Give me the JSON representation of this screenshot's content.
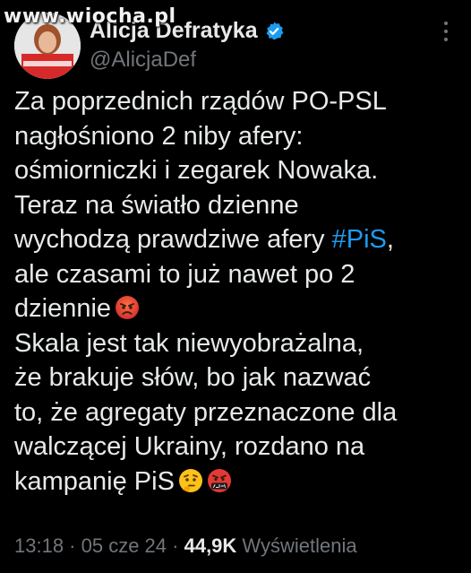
{
  "watermark": "www.wiocha.pl",
  "author": {
    "display_name": "Alicja Defratyka",
    "handle": "@AlicjaDef",
    "verified_icon": "verified-badge-icon",
    "verified_color": "#1d9bf0"
  },
  "tweet": {
    "lines": [
      "Za poprzednich rządów PO-PSL",
      "nagłośniono 2 niby afery:",
      "ośmiorniczki i zegarek Nowaka.",
      "Teraz na światło dzienne",
      "wychodzą prawdziwe afery ",
      "ale czasami to już nawet po 2",
      "dziennie",
      "Skala jest tak niewyobrażalna,",
      "że brakuje słów, bo jak nazwać",
      "to, że agregaty przeznaczone dla",
      "walczącej Ukrainy, rozdano na",
      "kampanię PiS"
    ],
    "hashtag": "#PiS",
    "hashtag_suffix": ",",
    "hashtag_color": "#1d9bf0",
    "emojis": [
      "angry-face-icon",
      "thinking-face-icon",
      "cursing-face-icon"
    ]
  },
  "meta": {
    "time": "13:18",
    "sep1": " · ",
    "date": "05 cze 24",
    "sep2": " · ",
    "views_count": "44,9K",
    "views_label": " Wyświetlenia"
  }
}
